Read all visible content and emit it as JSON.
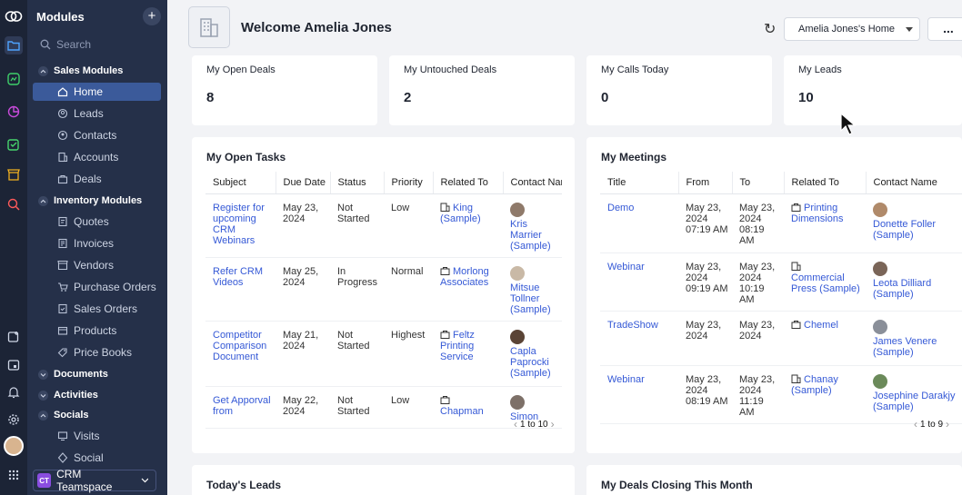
{
  "sidebar": {
    "header": "Modules",
    "search_placeholder": "Search",
    "sections": [
      {
        "label": "Sales Modules",
        "items": [
          "Home",
          "Leads",
          "Contacts",
          "Accounts",
          "Deals"
        ]
      },
      {
        "label": "Inventory Modules",
        "items": [
          "Quotes",
          "Invoices",
          "Vendors",
          "Purchase Orders",
          "Sales Orders",
          "Products",
          "Price Books"
        ]
      },
      {
        "label": "Documents"
      },
      {
        "label": "Activities"
      },
      {
        "label": "Socials",
        "items": [
          "Visits",
          "Social"
        ]
      }
    ],
    "teamspace": {
      "badge": "CT",
      "label": "CRM Teamspace"
    }
  },
  "header": {
    "welcome": "Welcome Amelia Jones",
    "home_select": "Amelia Jones's Home",
    "more": "..."
  },
  "kpis": [
    {
      "label": "My Open Deals",
      "value": "8"
    },
    {
      "label": "My Untouched Deals",
      "value": "2"
    },
    {
      "label": "My Calls Today",
      "value": "0"
    },
    {
      "label": "My Leads",
      "value": "10"
    }
  ],
  "tasks": {
    "title": "My Open Tasks",
    "columns": [
      "Subject",
      "Due Date",
      "Status",
      "Priority",
      "Related To",
      "Contact Nar"
    ],
    "rows": [
      {
        "subject": "Register for upcoming CRM Webinars",
        "due": "May 23, 2024",
        "status": "Not Started",
        "priority": "Low",
        "related": "King (Sample)",
        "related_icon": "building-icon",
        "contact": "Kris Marrier (Sample)",
        "avatar": "#8f7a6a"
      },
      {
        "subject": "Refer CRM Videos",
        "due": "May 25, 2024",
        "status": "In Progress",
        "priority": "Normal",
        "related": "Morlong Associates",
        "related_icon": "deal-icon",
        "contact": "Mitsue Tollner (Sample)",
        "avatar": "#c9b9a6"
      },
      {
        "subject": "Competitor Comparison Document",
        "due": "May 21, 2024",
        "status": "Not Started",
        "priority": "Highest",
        "related": "Feltz Printing Service",
        "related_icon": "deal-icon",
        "contact": "Capla Paprocki (Sample)",
        "avatar": "#5a4436"
      },
      {
        "subject": "Get Apporval from",
        "due": "May 22, 2024",
        "status": "Not Started",
        "priority": "Low",
        "related": "Chapman",
        "related_icon": "deal-icon",
        "contact": "Simon Morasca",
        "avatar": "#7d7068"
      }
    ],
    "pager": "1 to 10"
  },
  "meetings": {
    "title": "My Meetings",
    "columns": [
      "Title",
      "From",
      "To",
      "Related To",
      "Contact Name"
    ],
    "rows": [
      {
        "title": "Demo",
        "from": "May 23, 2024 07:19 AM",
        "to": "May 23, 2024 08:19 AM",
        "related": "Printing Dimensions",
        "related_icon": "deal-icon",
        "contact": "Donette Foller (Sample)",
        "avatar": "#b08a6a"
      },
      {
        "title": "Webinar",
        "from": "May 23, 2024 09:19 AM",
        "to": "May 23, 2024 10:19 AM",
        "related": "Commercial Press (Sample)",
        "related_icon": "building-icon",
        "contact": "Leota Dilliard (Sample)",
        "avatar": "#7a6558"
      },
      {
        "title": "TradeShow",
        "from": "May 23, 2024",
        "to": "May 23, 2024",
        "related": "Chemel",
        "related_icon": "deal-icon",
        "contact": "James Venere (Sample)",
        "avatar": "#8a8f99"
      },
      {
        "title": "Webinar",
        "from": "May 23, 2024 08:19 AM",
        "to": "May 23, 2024 11:19 AM",
        "related": "Chanay (Sample)",
        "related_icon": "building-icon",
        "contact": "Josephine Darakjy (Sample)",
        "avatar": "#6b8a5a"
      }
    ],
    "pager": "1 to 9"
  },
  "bottom": {
    "leads_title": "Today's Leads",
    "deals_title": "My Deals Closing This Month"
  },
  "colors": {
    "rail": "#1c2436",
    "sidebar": "#253049",
    "selected": "#3b5a9a",
    "link": "#3559d6",
    "page": "#f2f3f6"
  }
}
